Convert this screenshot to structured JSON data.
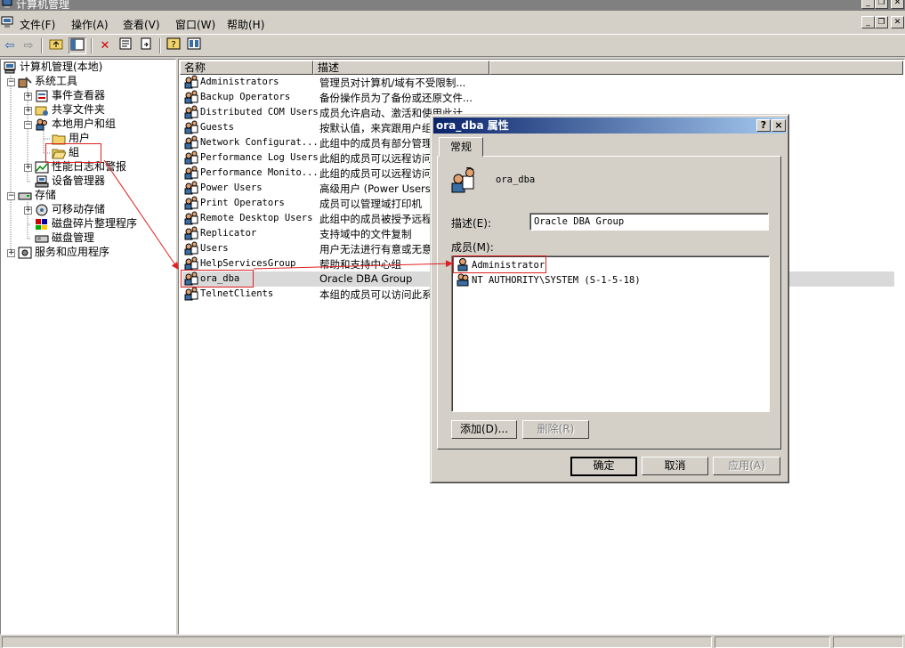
{
  "window": {
    "title": "计算机管理"
  },
  "menu": [
    "文件(F)",
    "操作(A)",
    "查看(V)",
    "窗口(W)",
    "帮助(H)"
  ],
  "tree": {
    "root": "计算机管理(本地)",
    "system_tools": "系统工具",
    "event_viewer": "事件查看器",
    "shared_folders": "共享文件夹",
    "local_users_groups": "本地用户和组",
    "users": "用户",
    "groups": "組",
    "perf_logs": "性能日志和警报",
    "device_manager": "设备管理器",
    "storage": "存储",
    "removable_storage": "可移动存储",
    "defrag": "磁盘碎片整理程序",
    "disk_mgmt": "磁盘管理",
    "services_apps": "服务和应用程序"
  },
  "list": {
    "col_name": "名称",
    "col_desc": "描述",
    "rows": [
      {
        "name": "Administrators",
        "desc": "管理员对计算机/域有不受限制..."
      },
      {
        "name": "Backup Operators",
        "desc": "备份操作员为了备份或还原文件..."
      },
      {
        "name": "Distributed COM Users",
        "desc": "成员允许启动、激活和使用此计"
      },
      {
        "name": "Guests",
        "desc": "按默认值，来宾跟用户组"
      },
      {
        "name": "Network Configurat...",
        "desc": "此组中的成员有部分管理"
      },
      {
        "name": "Performance Log Users",
        "desc": "此組的成员可以远程访问"
      },
      {
        "name": "Performance Monito...",
        "desc": "此组的成员可以远程访问"
      },
      {
        "name": "Power Users",
        "desc": "高级用户 (Power Users)"
      },
      {
        "name": "Print Operators",
        "desc": "成员可以管理域打印机"
      },
      {
        "name": "Remote Desktop Users",
        "desc": "此组中的成员被授予远程"
      },
      {
        "name": "Replicator",
        "desc": "支持域中的文件复制"
      },
      {
        "name": "Users",
        "desc": "用户无法进行有意或无意"
      },
      {
        "name": "HelpServicesGroup",
        "desc": "帮助和支持中心组"
      },
      {
        "name": "ora_dba",
        "desc": "Oracle DBA Group"
      },
      {
        "name": "TelnetClients",
        "desc": "本组的成员可以访问此系"
      }
    ]
  },
  "dialog": {
    "title": "ora_dba 属性",
    "help_btn": "?",
    "close_btn": "×",
    "tab_general": "常规",
    "group_name": "ora_dba",
    "desc_label": "描述(E):",
    "desc_value": "Oracle DBA Group",
    "members_label": "成员(M):",
    "members": [
      "Administrator",
      "NT AUTHORITY\\SYSTEM (S-1-5-18)"
    ],
    "add_btn": "添加(D)...",
    "remove_btn": "删除(R)",
    "ok_btn": "确定",
    "cancel_btn": "取消",
    "apply_btn": "应用(A)"
  },
  "colors": {
    "annotation": "#e02020",
    "title_active": "#0a246a",
    "selection": "#d9d9d9"
  }
}
